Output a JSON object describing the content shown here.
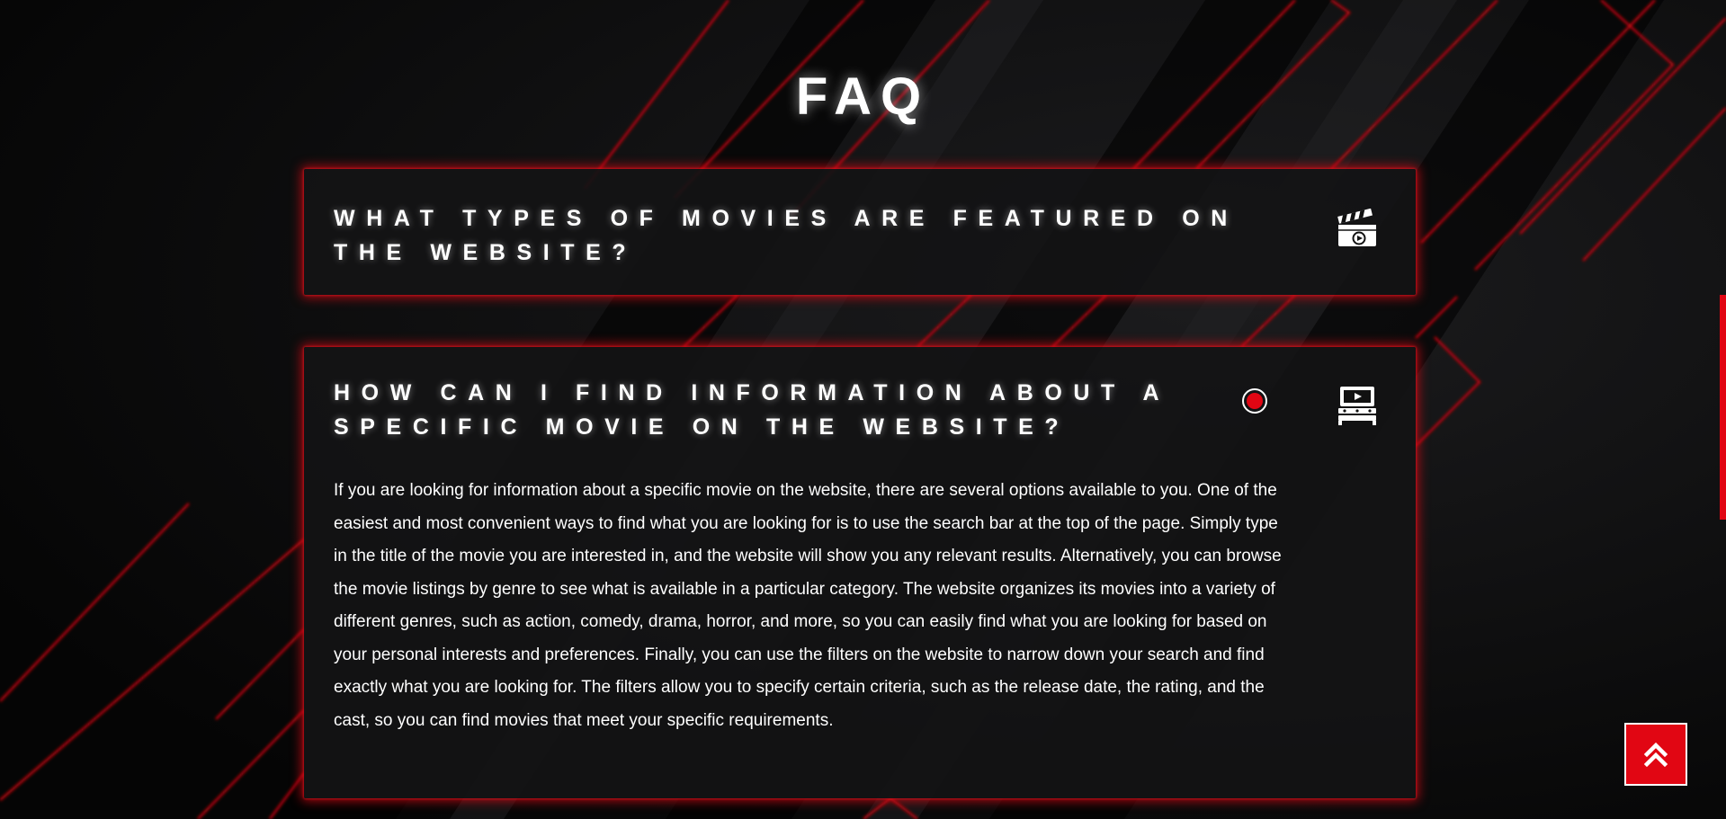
{
  "faq": {
    "title": "FAQ",
    "items": [
      {
        "question": "WHAT TYPES OF MOVIES ARE FEATURED ON THE WEBSITE?",
        "icon": "clapperboard-icon",
        "expanded": false
      },
      {
        "question": "HOW CAN I FIND INFORMATION ABOUT A SPECIFIC MOVIE ON THE WEBSITE?",
        "icon": "movie-theater-icon",
        "expanded": true,
        "answer": "If you are looking for information about a specific movie on the website, there are several options available to you. One of the easiest and most convenient ways to find what you are looking for is to use the search bar at the top of the page. Simply type in the title of the movie you are interested in, and the website will show you any relevant results. Alternatively, you can browse the movie listings by genre to see what is available in a particular category. The website organizes its movies into a variety of different genres, such as action, comedy, drama, horror, and more, so you can easily find what you are looking for based on your personal interests and preferences. Finally, you can use the filters on the website to narrow down your search and find exactly what you are looking for. The filters allow you to specify certain criteria, such as the release date, the rating, and the cast, so you can find movies that meet your specific requirements."
      }
    ]
  },
  "scroll_top_button": {
    "icon": "double-chevron-up-icon"
  },
  "colors": {
    "background": "#080808",
    "accent": "#e10613",
    "card": "#131315",
    "text": "#ffffff"
  }
}
